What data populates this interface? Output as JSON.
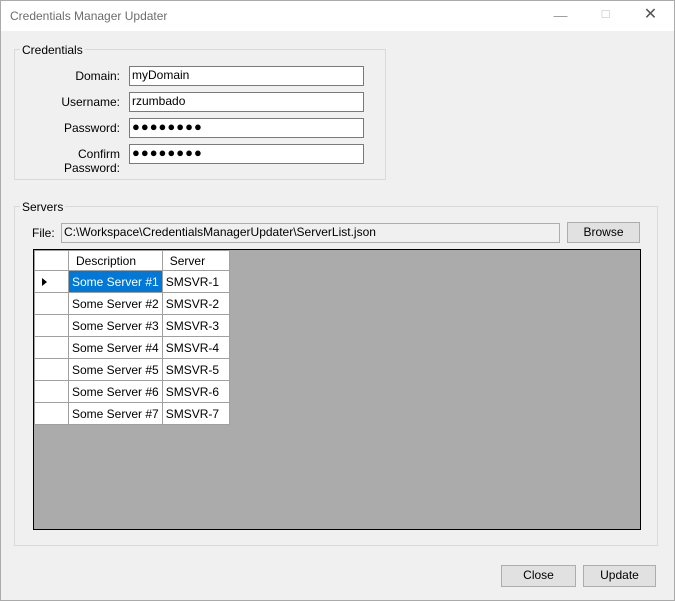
{
  "window": {
    "title": "Credentials Manager Updater",
    "min_icon": "—",
    "max_icon": "☐",
    "close_icon": "✕"
  },
  "credentials": {
    "legend": "Credentials",
    "domain_label": "Domain:",
    "domain_value": "myDomain",
    "username_label": "Username:",
    "username_value": "rzumbado",
    "password_label": "Password:",
    "password_value": "●●●●●●●●",
    "confirm_label": "Confirm Password:",
    "confirm_value": "●●●●●●●●"
  },
  "servers": {
    "legend": "Servers",
    "file_label": "File:",
    "file_value": "C:\\Workspace\\CredentialsManagerUpdater\\ServerList.json",
    "browse_label": "Browse",
    "columns": [
      "Description",
      "Server"
    ],
    "rows": [
      {
        "description": "Some Server #1",
        "server": "SMSVR-1"
      },
      {
        "description": "Some Server #2",
        "server": "SMSVR-2"
      },
      {
        "description": "Some Server #3",
        "server": "SMSVR-3"
      },
      {
        "description": "Some Server #4",
        "server": "SMSVR-4"
      },
      {
        "description": "Some Server #5",
        "server": "SMSVR-5"
      },
      {
        "description": "Some Server #6",
        "server": "SMSVR-6"
      },
      {
        "description": "Some Server #7",
        "server": "SMSVR-7"
      }
    ],
    "selected_row": 0
  },
  "footer": {
    "close_label": "Close",
    "update_label": "Update"
  },
  "colors": {
    "selection": "#0078d7",
    "grid_background": "#ababab",
    "window_background": "#f0f0f0"
  }
}
